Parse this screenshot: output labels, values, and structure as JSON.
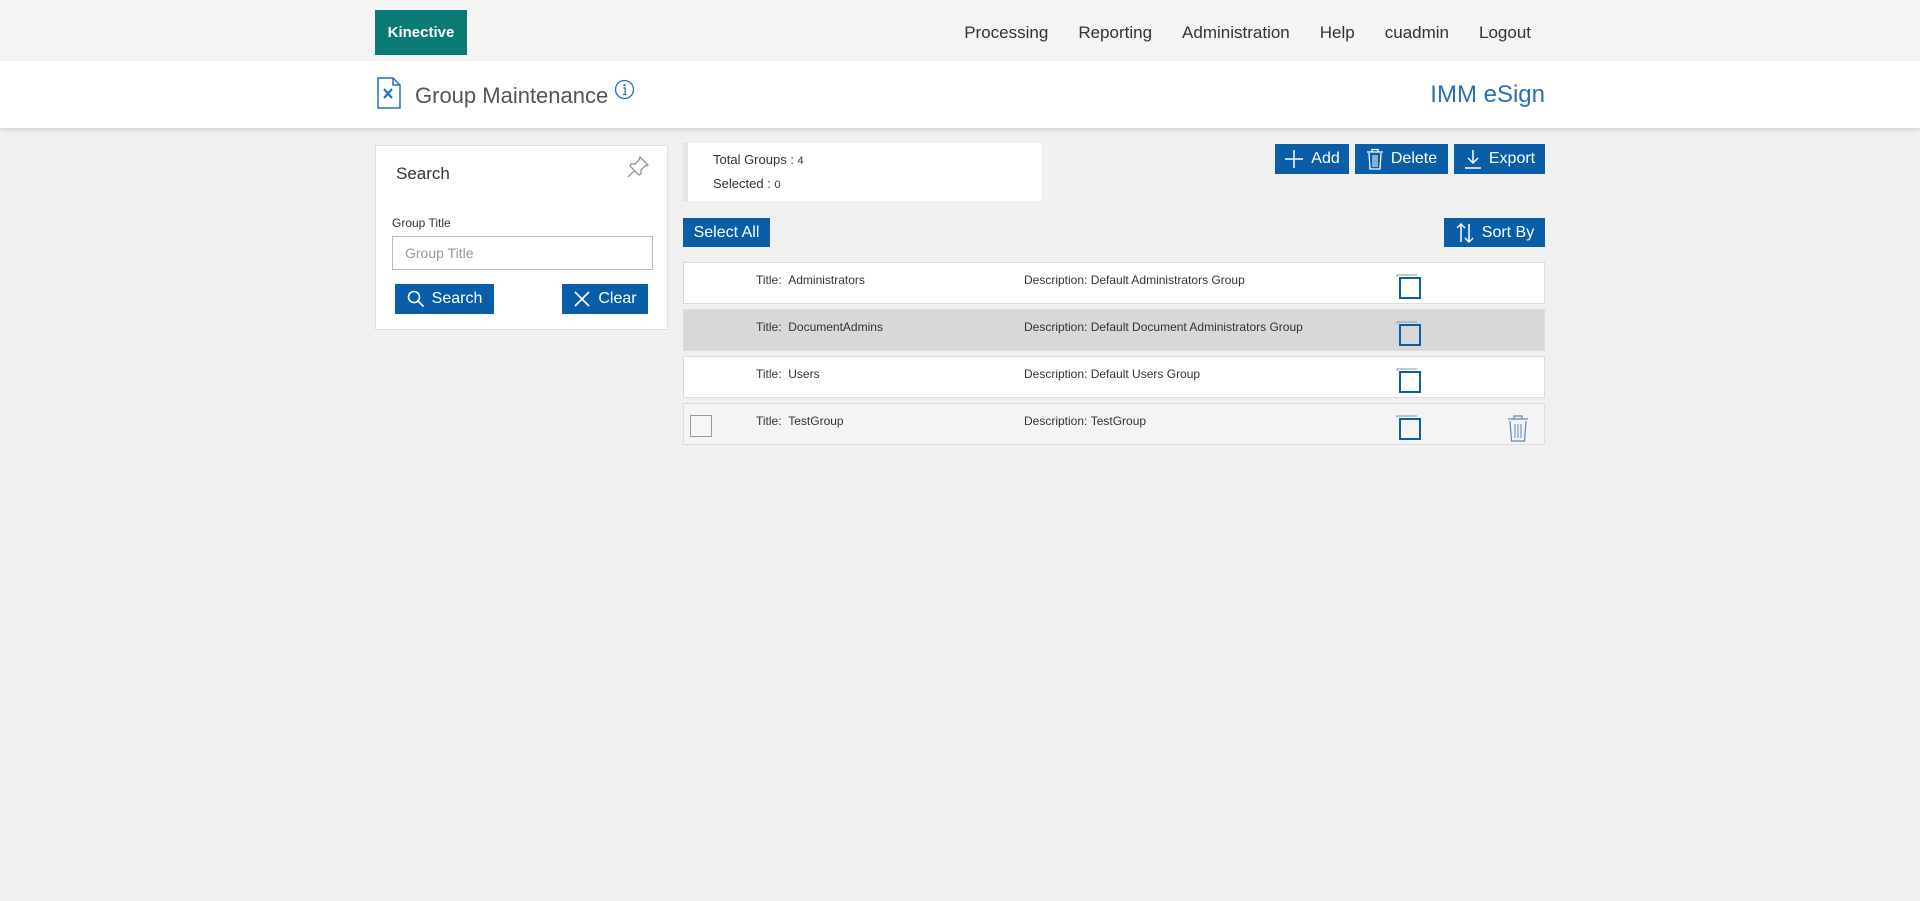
{
  "header": {
    "logo": "Kinective",
    "nav": [
      "Processing",
      "Reporting",
      "Administration",
      "Help",
      "cuadmin",
      "Logout"
    ]
  },
  "titlebar": {
    "page_title": "Group Maintenance",
    "app_name": "IMM eSign"
  },
  "search": {
    "heading": "Search",
    "field_label": "Group Title",
    "field_placeholder": "Group Title",
    "field_value": "",
    "search_label": "Search",
    "clear_label": "Clear"
  },
  "summary": {
    "total_label": "Total Groups : ",
    "total_value": "4",
    "selected_label": "Selected : ",
    "selected_value": "0"
  },
  "toolbar": {
    "add_label": "Add",
    "delete_label": "Delete",
    "export_label": "Export",
    "select_all_label": "Select All",
    "sort_label": "Sort By"
  },
  "groups": [
    {
      "title_label": "Title:",
      "title": "Administrators",
      "desc_label": "Description:",
      "description": "Default Administrators Group",
      "highlighted": false,
      "deletable": false
    },
    {
      "title_label": "Title:",
      "title": "DocumentAdmins",
      "desc_label": "Description:",
      "description": "Default Document Administrators Group",
      "highlighted": true,
      "deletable": false
    },
    {
      "title_label": "Title:",
      "title": "Users",
      "desc_label": "Description:",
      "description": "Default Users Group",
      "highlighted": false,
      "deletable": false
    },
    {
      "title_label": "Title:",
      "title": "TestGroup",
      "desc_label": "Description:",
      "description": "TestGroup",
      "highlighted": false,
      "deletable": true
    }
  ],
  "colors": {
    "brand": "#0b7a75",
    "button": "#0a5ea8",
    "app_name": "#2a6ebb",
    "row_highlight": "#d8d8d8",
    "row_alt": "#f4f4f4"
  }
}
